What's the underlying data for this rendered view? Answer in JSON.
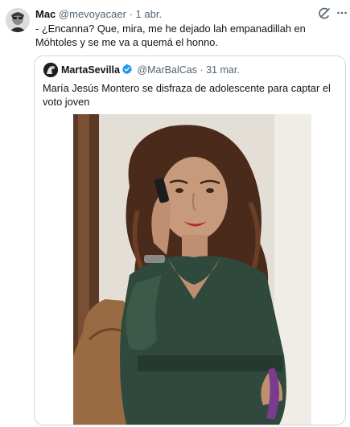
{
  "tweet": {
    "author_name": "Mac",
    "author_handle": "@mevoyacaer",
    "separator": "·",
    "date": "1 abr.",
    "text": "- ¿Encanna? Que, mira, me he dejado lah empanadillah en Móhtoles y se me va a quemá el honno."
  },
  "quoted_tweet": {
    "author_name": "MartaSevilla",
    "author_handle": "@MarBalCas",
    "separator": "·",
    "date": "31 mar.",
    "text": "María Jesús Montero se disfraza de adolescente para captar el voto joven"
  },
  "icons": {
    "grok": "grok-icon",
    "more": "more-options-icon",
    "verified": "verified-badge-icon"
  },
  "colors": {
    "verified_blue": "#1d9bf0",
    "muted_text": "#536471",
    "border": "#cfd9de"
  }
}
